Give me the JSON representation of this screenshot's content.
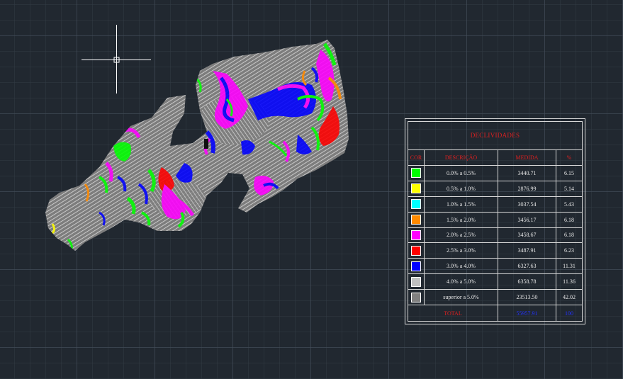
{
  "legend": {
    "title": "DECLIVIDADES",
    "headers": {
      "cor": "COR",
      "descricao": "DESCRIÇÃO",
      "medida": "MEDIDA",
      "percent": "%"
    },
    "rows": [
      {
        "descricao": "0.0% a 0.5%",
        "medida": "3440.71",
        "percent": "6.15",
        "color": "#00ff00"
      },
      {
        "descricao": "0.5% a 1.0%",
        "medida": "2876.99",
        "percent": "5.14",
        "color": "#ffff00"
      },
      {
        "descricao": "1.0% a 1.5%",
        "medida": "3037.54",
        "percent": "5.43",
        "color": "#00ffff"
      },
      {
        "descricao": "1.5% a 2.0%",
        "medida": "3456.17",
        "percent": "6.18",
        "color": "#ff8a00"
      },
      {
        "descricao": "2.0% a 2.5%",
        "medida": "3458.67",
        "percent": "6.18",
        "color": "#ff00ff"
      },
      {
        "descricao": "2.5% a 3.0%",
        "medida": "3487.91",
        "percent": "6.23",
        "color": "#ff0000"
      },
      {
        "descricao": "3.0% a 4.0%",
        "medida": "6327.63",
        "percent": "11.31",
        "color": "#0000ff"
      },
      {
        "descricao": "4.0% a 5.0%",
        "medida": "6358.78",
        "percent": "11.36",
        "color": "#c0c0c0"
      },
      {
        "descricao": "superior a 5.0%",
        "medida": "23513.50",
        "percent": "42.02",
        "color": "#808080"
      }
    ],
    "total": {
      "label": "TOTAL",
      "medida": "55957.91",
      "percent": "100"
    }
  },
  "colors": {
    "background": "#212830",
    "terrain_base": "#8c8c8c",
    "hatch": "#d6d6d6"
  },
  "icons": {
    "cursor": "crosshair-cursor-icon"
  }
}
